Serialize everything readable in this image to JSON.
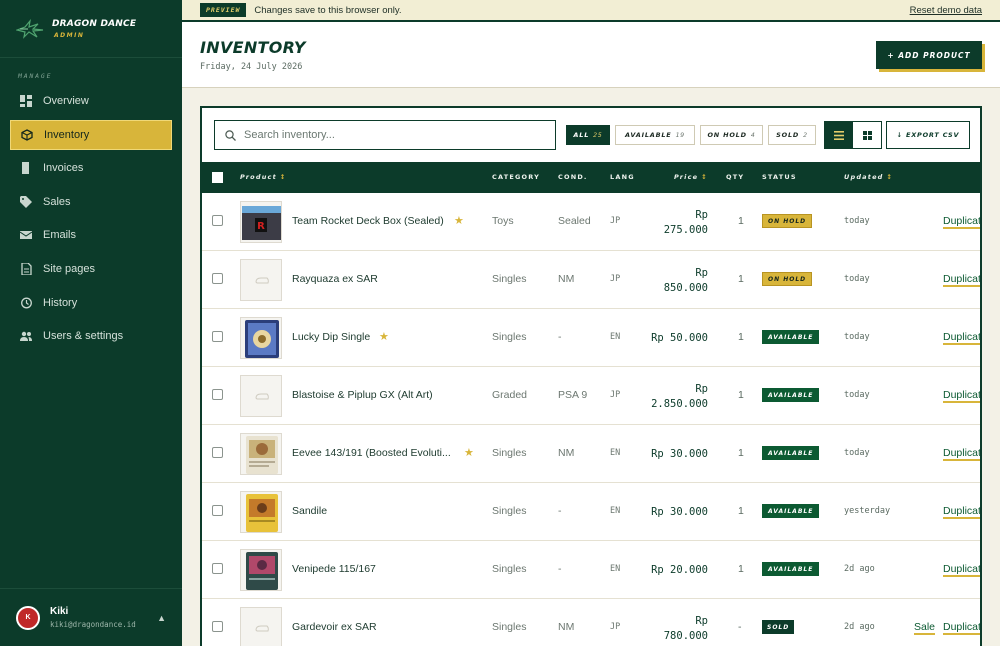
{
  "brand": {
    "name": "DRAGON DANCE",
    "sub": "ADMIN"
  },
  "sidebar": {
    "section": "MANAGE",
    "items": [
      {
        "label": "Overview",
        "icon": "grid-icon"
      },
      {
        "label": "Inventory",
        "icon": "box-icon",
        "active": true
      },
      {
        "label": "Invoices",
        "icon": "invoice-icon"
      },
      {
        "label": "Sales",
        "icon": "tag-icon"
      },
      {
        "label": "Emails",
        "icon": "mail-icon"
      },
      {
        "label": "Site pages",
        "icon": "page-icon"
      },
      {
        "label": "History",
        "icon": "history-icon"
      },
      {
        "label": "Users & settings",
        "icon": "users-icon"
      }
    ],
    "user": {
      "initial": "K",
      "name": "Kiki",
      "email": "kiki@dragondance.id"
    }
  },
  "preview": {
    "badge": "PREVIEW",
    "text": "Changes save to this browser only.",
    "reset": "Reset demo data"
  },
  "header": {
    "title": "INVENTORY",
    "date": "Friday, 24 July 2026",
    "add_label": "+ ADD PRODUCT"
  },
  "toolbar": {
    "search_placeholder": "Search inventory...",
    "filters": [
      {
        "label": "ALL",
        "count": "25",
        "active": true
      },
      {
        "label": "AVAILABLE",
        "count": "19"
      },
      {
        "label": "ON HOLD",
        "count": "4"
      },
      {
        "label": "SOLD",
        "count": "2"
      }
    ],
    "export_label": "↓ EXPORT CSV"
  },
  "table": {
    "headers": {
      "product": "Product",
      "category": "CATEGORY",
      "cond": "COND.",
      "lang": "LANG",
      "price": "Price",
      "qty": "QTY",
      "status": "STATUS",
      "updated": "Updated"
    },
    "rows": [
      {
        "name": "Team Rocket Deck Box (Sealed)",
        "star": true,
        "category": "Toys",
        "cond": "Sealed",
        "lang": "JP",
        "price_top": "Rp",
        "price": "275.000",
        "qty": "1",
        "status": "ON HOLD",
        "updated": "today",
        "action": "Duplicat",
        "sale": ""
      },
      {
        "name": "Rayquaza ex SAR",
        "star": false,
        "category": "Singles",
        "cond": "NM",
        "lang": "JP",
        "price_top": "Rp",
        "price": "850.000",
        "qty": "1",
        "status": "ON HOLD",
        "updated": "today",
        "action": "Duplicat",
        "sale": ""
      },
      {
        "name": "Lucky Dip Single",
        "star": true,
        "category": "Singles",
        "cond": "-",
        "lang": "EN",
        "price_top": "",
        "price": "Rp 50.000",
        "qty": "1",
        "status": "AVAILABLE",
        "updated": "today",
        "action": "Duplicat",
        "sale": ""
      },
      {
        "name": "Blastoise & Piplup GX (Alt Art)",
        "star": false,
        "category": "Graded",
        "cond": "PSA 9",
        "lang": "JP",
        "price_top": "Rp",
        "price": "2.850.000",
        "qty": "1",
        "status": "AVAILABLE",
        "updated": "today",
        "action": "Duplicat",
        "sale": ""
      },
      {
        "name": "Eevee 143/191 (Boosted Evoluti...",
        "star": true,
        "category": "Singles",
        "cond": "NM",
        "lang": "EN",
        "price_top": "",
        "price": "Rp 30.000",
        "qty": "1",
        "status": "AVAILABLE",
        "updated": "today",
        "action": "Duplicat",
        "sale": ""
      },
      {
        "name": "Sandile",
        "star": false,
        "category": "Singles",
        "cond": "-",
        "lang": "EN",
        "price_top": "",
        "price": "Rp 30.000",
        "qty": "1",
        "status": "AVAILABLE",
        "updated": "yesterday",
        "action": "Duplicat",
        "sale": ""
      },
      {
        "name": "Venipede 115/167",
        "star": false,
        "category": "Singles",
        "cond": "-",
        "lang": "EN",
        "price_top": "",
        "price": "Rp 20.000",
        "qty": "1",
        "status": "AVAILABLE",
        "updated": "2d ago",
        "action": "Duplicat",
        "sale": ""
      },
      {
        "name": "Gardevoir ex SAR",
        "star": false,
        "category": "Singles",
        "cond": "NM",
        "lang": "JP",
        "price_top": "Rp",
        "price": "780.000",
        "qty": "-",
        "status": "SOLD",
        "updated": "2d ago",
        "action": "Duplicat",
        "sale": "Sale"
      }
    ]
  },
  "colors": {
    "sidebar_bg": "#0c3b2a",
    "accent_gold": "#d8b53a",
    "available_green": "#0c5a32",
    "page_bg": "#f3f1e6"
  }
}
